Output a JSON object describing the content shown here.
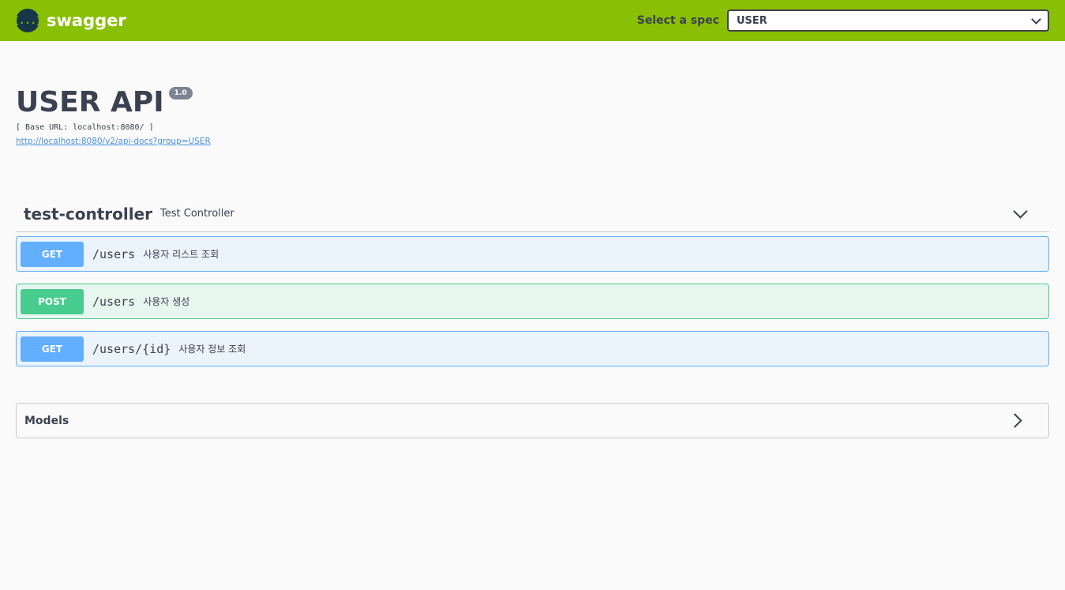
{
  "topbar": {
    "logo_glyph": "{...}",
    "brand": "swagger",
    "spec_label": "Select a spec",
    "spec_selected": "USER"
  },
  "info": {
    "title": "USER API",
    "version": "1.0",
    "base_url": "[ Base URL: localhost:8080/ ]",
    "spec_link": "http://localhost:8080/v2/api-docs?group=USER"
  },
  "tag": {
    "name": "test-controller",
    "description": "Test Controller"
  },
  "operations": [
    {
      "method": "GET",
      "path": "/users",
      "summary": "사용자 리스트 조회"
    },
    {
      "method": "POST",
      "path": "/users",
      "summary": "사용자 생성"
    },
    {
      "method": "GET",
      "path": "/users/{id}",
      "summary": "사용자 정보 조회"
    }
  ],
  "models": {
    "title": "Models"
  },
  "colors": {
    "topbar": "#89bf04",
    "get": "#61affe",
    "post": "#49cc90",
    "text": "#3b4151",
    "link": "#4990e2"
  }
}
